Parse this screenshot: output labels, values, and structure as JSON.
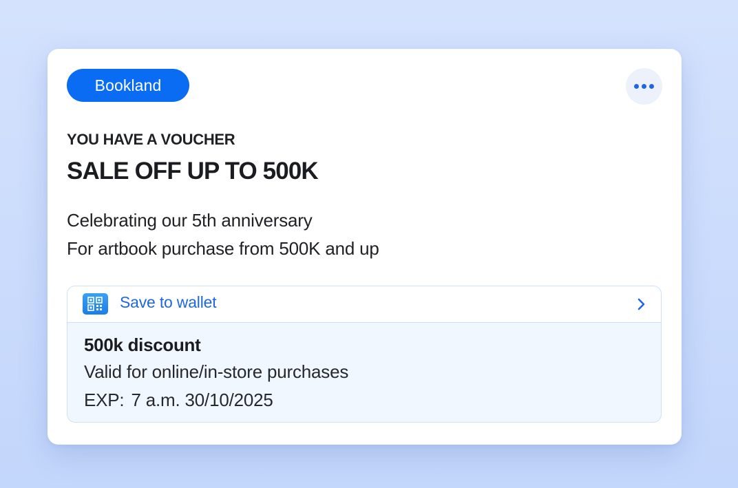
{
  "card": {
    "brand": "Bookland",
    "eyebrow": "YOU HAVE A VOUCHER",
    "headline": "SALE OFF UP TO 500K",
    "description": [
      "Celebrating our 5th anniversary",
      "For artbook purchase from 500K and up"
    ],
    "more_icon": "more-horizontal-icon"
  },
  "voucher": {
    "wallet_icon": "qr-code-icon",
    "wallet_label": "Save to wallet",
    "chevron_icon": "chevron-right-icon",
    "discount_title": "500k discount",
    "validity": "Valid for online/in-store purchases",
    "exp_label": "EXP:",
    "exp_value": "7 a.m. 30/10/2025"
  },
  "colors": {
    "background": "#d4e2fd",
    "brand_pill": "#0a6cf2",
    "accent": "#1f67e0",
    "voucher_bg": "#f1f7fe",
    "voucher_border": "#cfe0f6"
  }
}
